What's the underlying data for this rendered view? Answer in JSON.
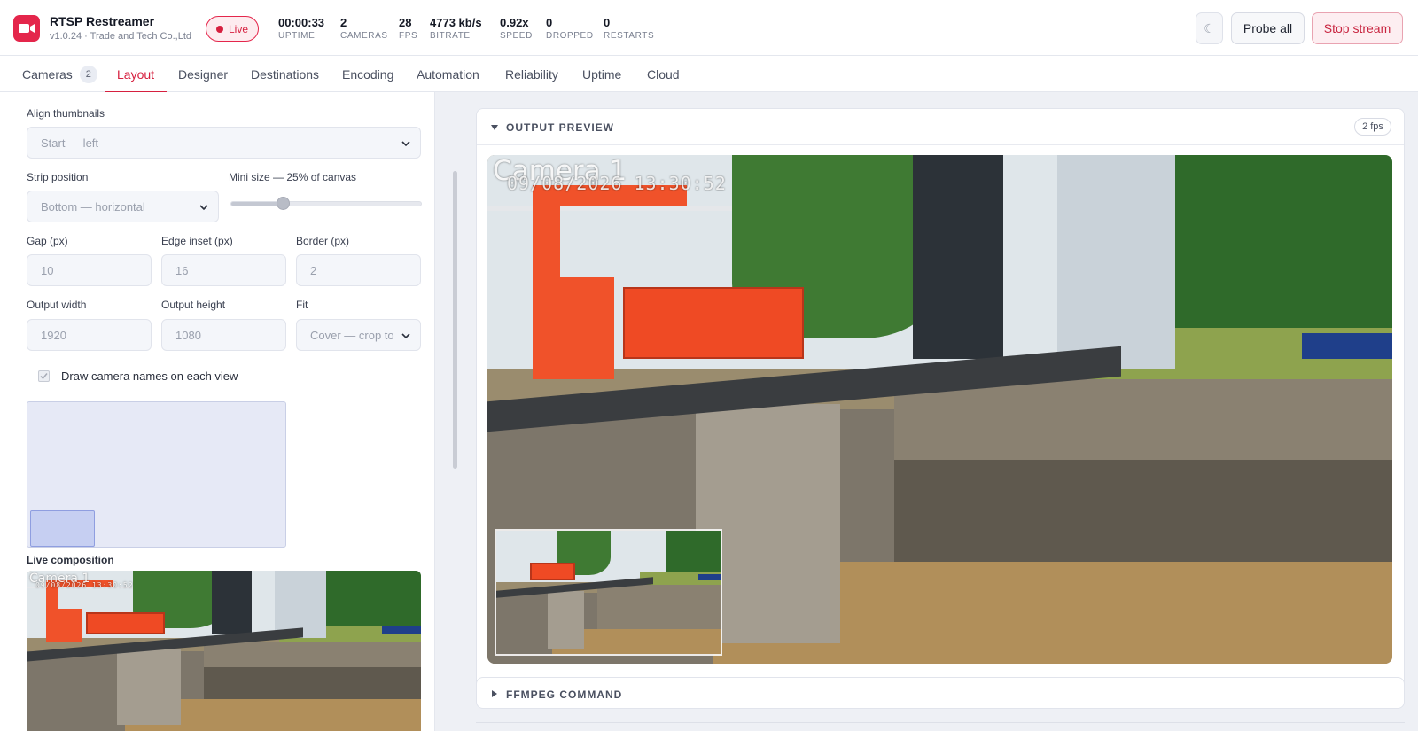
{
  "app": {
    "title": "RTSP Restreamer",
    "subtitle": "v1.0.24 · Trade and Tech Co.,Ltd",
    "brand_color": "#e4264b",
    "logo_icon": "video-camera-icon",
    "live_label": "Live"
  },
  "stats": [
    {
      "value": "00:00:33",
      "label": "UPTIME"
    },
    {
      "value": "2",
      "label": "CAMERAS"
    },
    {
      "value": "28",
      "label": "FPS"
    },
    {
      "value": "4773 kb/s",
      "label": "BITRATE"
    },
    {
      "value": "0.92x",
      "label": "SPEED"
    },
    {
      "value": "0",
      "label": "DROPPED"
    },
    {
      "value": "0",
      "label": "RESTARTS"
    }
  ],
  "header_buttons": {
    "theme_icon": "☾",
    "probe_all": "Probe all",
    "stop_stream": "Stop stream"
  },
  "tabs": [
    {
      "label": "Cameras",
      "count": "2"
    },
    {
      "label": "Layout",
      "active": true
    },
    {
      "label": "Designer"
    },
    {
      "label": "Destinations"
    },
    {
      "label": "Encoding"
    },
    {
      "label": "Automation"
    },
    {
      "label": "Reliability"
    },
    {
      "label": "Uptime"
    },
    {
      "label": "Cloud"
    }
  ],
  "layout_form": {
    "align_thumbnails": {
      "label": "Align thumbnails",
      "value": "Start — left"
    },
    "strip_position": {
      "label": "Strip position",
      "value": "Bottom — horizontal"
    },
    "mini_size": {
      "label": "Mini size — 25% of canvas",
      "percent": 25
    },
    "gap": {
      "label": "Gap (px)",
      "value": "10"
    },
    "edge_inset": {
      "label": "Edge inset (px)",
      "value": "16"
    },
    "border": {
      "label": "Border (px)",
      "value": "2"
    },
    "output_width": {
      "label": "Output width",
      "value": "1920"
    },
    "output_height": {
      "label": "Output height",
      "value": "1080"
    },
    "fit": {
      "label": "Fit",
      "value": "Cover — crop to"
    },
    "draw_names": {
      "label": "Draw camera names on each view",
      "checked": true
    },
    "live_composition_label": "Live composition"
  },
  "camera_overlay": {
    "name": "Camera 1",
    "timestamp": "09/08/2026 13:30:52"
  },
  "output_preview": {
    "title": "OUTPUT PREVIEW",
    "fps_badge": "2 fps"
  },
  "ffmpeg": {
    "title": "FFMPEG COMMAND"
  }
}
